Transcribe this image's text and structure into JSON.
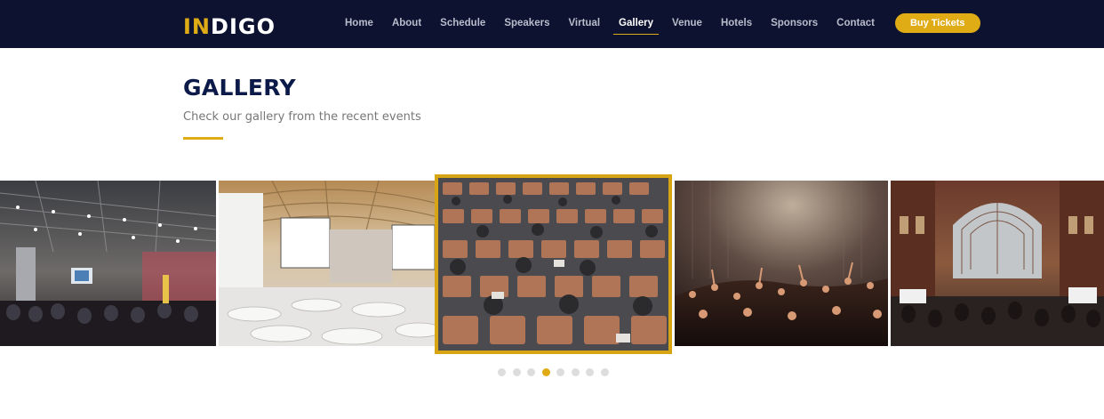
{
  "brand": {
    "logo_part1": "IN",
    "logo_part2": "DIGO",
    "accent": "#e0ac15",
    "navbar_bg": "#0c1230"
  },
  "nav": {
    "items": [
      {
        "label": "Home",
        "active": false
      },
      {
        "label": "About",
        "active": false
      },
      {
        "label": "Schedule",
        "active": false
      },
      {
        "label": "Speakers",
        "active": false
      },
      {
        "label": "Virtual",
        "active": false
      },
      {
        "label": "Gallery",
        "active": true
      },
      {
        "label": "Venue",
        "active": false
      },
      {
        "label": "Hotels",
        "active": false
      },
      {
        "label": "Sponsors",
        "active": false
      },
      {
        "label": "Contact",
        "active": false
      }
    ],
    "cta_label": "Buy Tickets"
  },
  "section": {
    "title": "GALLERY",
    "subtitle": "Check our gallery from the recent events"
  },
  "gallery": {
    "photos": [
      {
        "name": "conference-hall-photo",
        "active": false
      },
      {
        "name": "auditorium-screens-photo",
        "active": false
      },
      {
        "name": "audience-seats-photo",
        "active": true
      },
      {
        "name": "concert-crowd-photo",
        "active": false
      },
      {
        "name": "exhibition-hall-photo",
        "active": false
      }
    ],
    "dots_total": 8,
    "dots_active_index": 3
  }
}
